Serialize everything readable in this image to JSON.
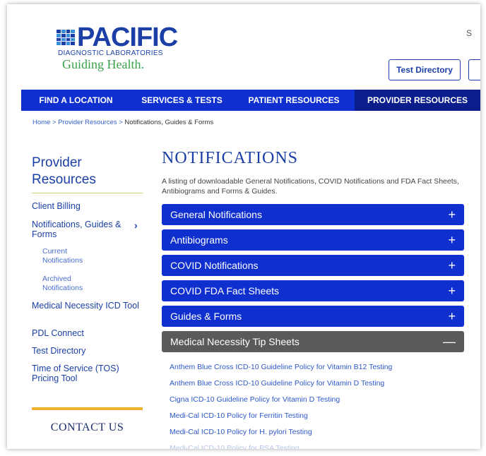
{
  "header": {
    "brand_name": "PACIFIC",
    "brand_sub": "DIAGNOSTIC LABORATORIES",
    "brand_tagline": "Guiding Health.",
    "search_glyph": "S",
    "test_directory_button": "Test Directory"
  },
  "nav": {
    "items": [
      {
        "label": "FIND A LOCATION"
      },
      {
        "label": "SERVICES & TESTS"
      },
      {
        "label": "PATIENT RESOURCES"
      },
      {
        "label": "PROVIDER RESOURCES"
      }
    ]
  },
  "breadcrumb": {
    "home": "Home",
    "sep1": " > ",
    "parent": "Provider Resources",
    "sep2": " > ",
    "current": "Notifications, Guides & Forms"
  },
  "sidebar": {
    "title": "Provider Resources",
    "items": [
      {
        "label": "Client Billing"
      },
      {
        "label": "Notifications, Guides & Forms"
      },
      {
        "label": "Current Notifications"
      },
      {
        "label": "Archived Notifications"
      },
      {
        "label": "Medical Necessity ICD Tool"
      },
      {
        "label": "PDL Connect"
      },
      {
        "label": "Test Directory"
      },
      {
        "label": "Time of Service (TOS) Pricing Tool"
      }
    ],
    "chevron": "›",
    "contact_title": "CONTACT US"
  },
  "main": {
    "title": "NOTIFICATIONS",
    "description": "A listing of downloadable General Notifications, COVID Notifications and FDA Fact Sheets, Antibiograms and Forms & Guides.",
    "accordion": [
      {
        "label": "General Notifications",
        "toggle": "+"
      },
      {
        "label": "Antibiograms",
        "toggle": "+"
      },
      {
        "label": "COVID Notifications",
        "toggle": "+"
      },
      {
        "label": "COVID FDA Fact Sheets",
        "toggle": "+"
      },
      {
        "label": "Guides & Forms",
        "toggle": "+"
      },
      {
        "label": "Medical Necessity Tip Sheets",
        "toggle": "—"
      }
    ],
    "tip_links": [
      {
        "label": "Anthem Blue Cross ICD-10 Guideline Policy for Vitamin B12 Testing"
      },
      {
        "label": "Anthem Blue Cross ICD-10 Guideline Policy for Vitamin D Testing"
      },
      {
        "label": "Cigna ICD-10 Guideline Policy for Vitamin D Testing"
      },
      {
        "label": "Medi-Cal ICD-10 Policy for Ferritin Testing"
      },
      {
        "label": "Medi-Cal ICD-10 Policy for H. pylori Testing"
      },
      {
        "label": "Medi-Cal ICD-10 Policy for PSA Testing"
      }
    ]
  },
  "colors": {
    "brand_blue": "#1b3fa6",
    "nav_blue": "#0f2fcf",
    "nav_active": "#0a1d8a",
    "tagline_green": "#3aa14a",
    "accordion_open": "#5a5a5a",
    "contact_accent": "#f1b12c"
  }
}
